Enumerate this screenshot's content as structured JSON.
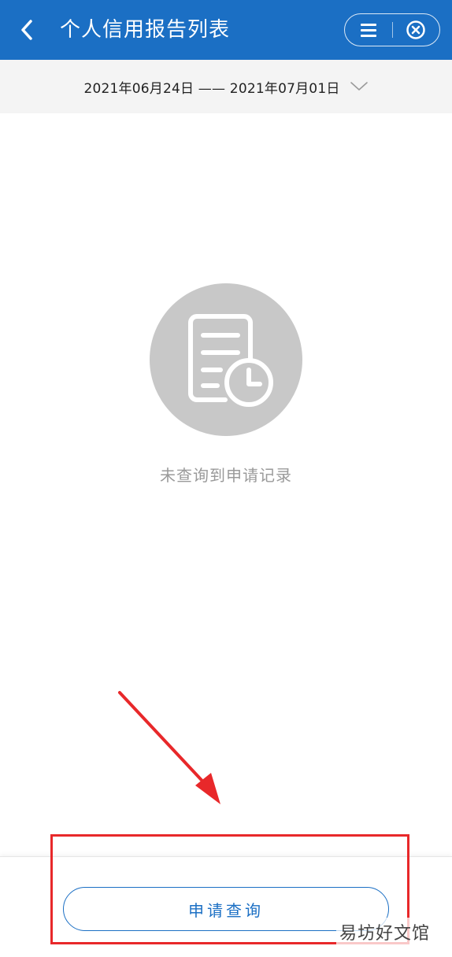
{
  "header": {
    "title": "个人信用报告列表",
    "back_icon": "chevron-left-icon",
    "menu_icon": "menu-icon",
    "close_icon": "close-circle-icon"
  },
  "date_filter": {
    "range_text": "2021年06月24日 —— 2021年07月01日",
    "chevron_icon": "chevron-down-icon"
  },
  "empty_state": {
    "icon": "document-clock-icon",
    "message": "未查询到申请记录"
  },
  "bottom": {
    "apply_button_label": "申请查询"
  },
  "watermark": {
    "text": "易坊好文馆"
  },
  "colors": {
    "primary": "#1b6fc4",
    "annotation": "#e8282a",
    "empty_circle": "#c8c8c8",
    "muted_text": "#9a9a9a"
  }
}
